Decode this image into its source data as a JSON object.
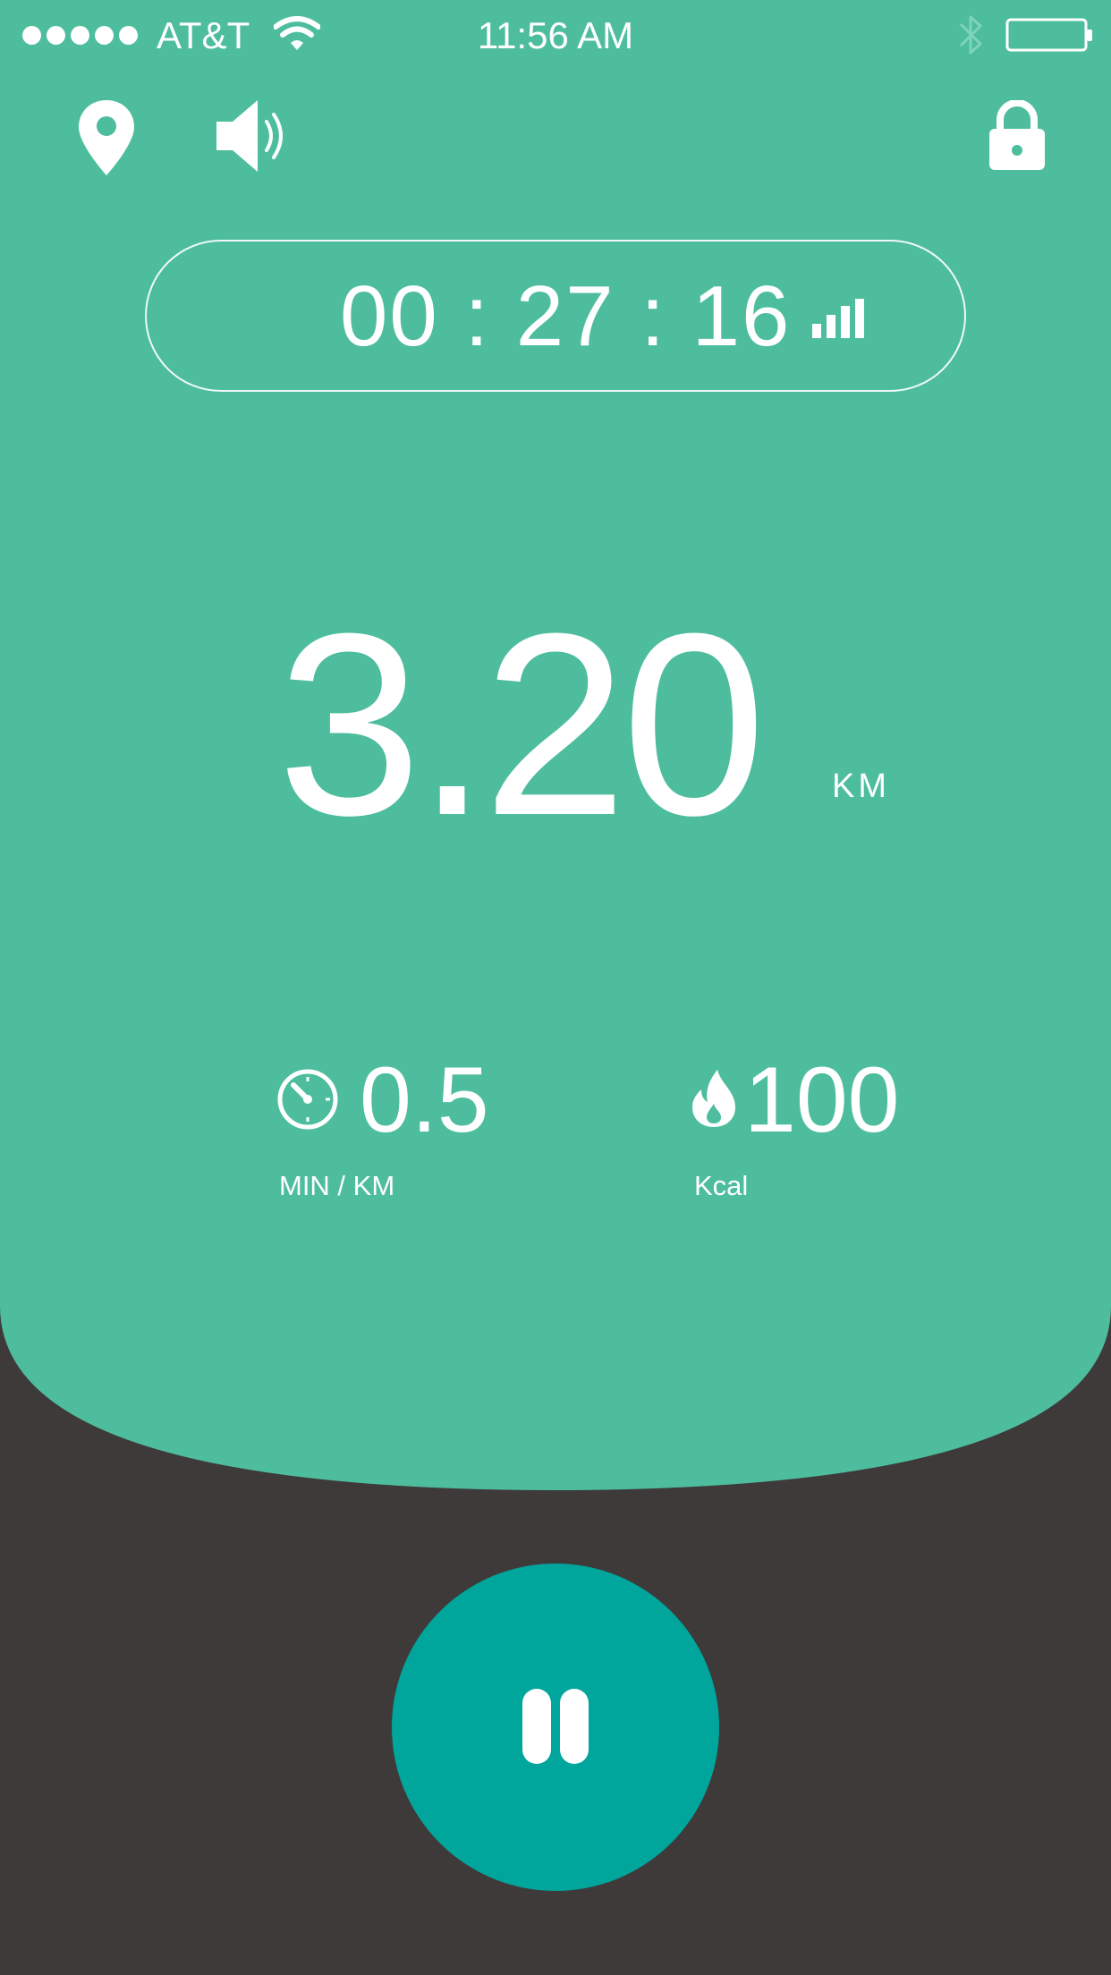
{
  "status_bar": {
    "carrier": "AT&T",
    "time": "11:56 AM",
    "icons": [
      "signal-dots",
      "wifi-icon",
      "bluetooth-icon",
      "battery-icon"
    ]
  },
  "toolbar": {
    "icons": [
      "location-pin-icon",
      "speaker-icon",
      "lock-icon"
    ]
  },
  "timer": {
    "value": "00 : 27 : 16",
    "icon": "signal-strength-icon"
  },
  "distance": {
    "value": "3.20",
    "unit": "KM"
  },
  "stats": {
    "pace": {
      "icon": "stopwatch-icon",
      "value": "0.5",
      "label": "MIN / KM"
    },
    "calories": {
      "icon": "flame-icon",
      "value": "100",
      "label": "Kcal"
    }
  },
  "controls": {
    "pause_icon": "pause-icon"
  },
  "colors": {
    "panel": "#4dbd9e",
    "background": "#3e3a3a",
    "button": "#00a69c"
  }
}
